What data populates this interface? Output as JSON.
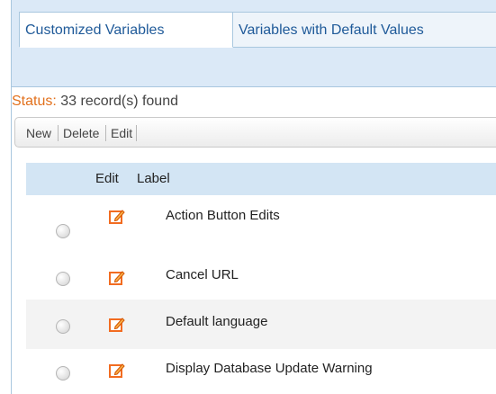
{
  "tabs": {
    "customized": "Customized Variables",
    "defaults": "Variables with Default Values"
  },
  "status": {
    "label": "Status:",
    "text": "33 record(s) found"
  },
  "toolbar": {
    "new_label": "New",
    "delete_label": "Delete",
    "edit_label": "Edit"
  },
  "grid": {
    "columns": {
      "edit": "Edit",
      "label": "Label"
    },
    "rows": [
      {
        "label": "Action Button Edits"
      },
      {
        "label": "Cancel URL"
      },
      {
        "label": "Default language"
      },
      {
        "label": "Display Database Update Warning"
      }
    ]
  },
  "icons": {
    "row_edit": "edit-pencil-icon",
    "row_select": "radio-icon"
  },
  "colors": {
    "accent_blue": "#1f5a99",
    "status_orange": "#e2711d",
    "header_bg": "#d3e5f4",
    "tabbar_bg": "#dbe9f7",
    "edit_icon_orange": "#f26c21"
  }
}
